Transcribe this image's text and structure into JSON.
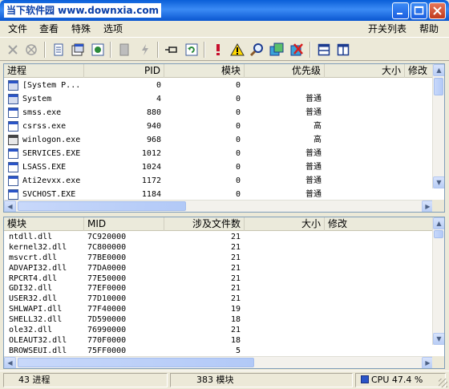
{
  "window": {
    "title": "当下软件园 www.downxia.com"
  },
  "menu": {
    "left": [
      "文件",
      "查看",
      "特殊",
      "选项"
    ],
    "right": [
      "开关列表",
      "帮助"
    ]
  },
  "toolbar": {
    "icons": [
      "close-icon",
      "kill-tree-icon",
      "document-icon",
      "properties-icon",
      "refresh-window-icon",
      "suspend-icon",
      "lightning-icon",
      "pin-icon",
      "reload-icon",
      "exclamation-icon",
      "warning-icon",
      "magnifier-icon",
      "dll-search-icon",
      "red-x-icon",
      "split-horizontal-icon",
      "split-vertical-icon"
    ]
  },
  "process_panel": {
    "columns": [
      "进程",
      "PID",
      "模块",
      "优先级",
      "大小",
      "修改"
    ],
    "rows": [
      {
        "name": "[System P...",
        "pid": "0",
        "modules": "0",
        "priority": "",
        "icon": "system-process-icon"
      },
      {
        "name": "System",
        "pid": "4",
        "modules": "0",
        "priority": "普通",
        "icon": "system-process-icon"
      },
      {
        "name": "smss.exe",
        "pid": "880",
        "modules": "0",
        "priority": "普通",
        "icon": "window-app-icon"
      },
      {
        "name": "csrss.exe",
        "pid": "940",
        "modules": "0",
        "priority": "高",
        "icon": "window-app-icon"
      },
      {
        "name": "winlogon.exe",
        "pid": "968",
        "modules": "0",
        "priority": "高",
        "icon": "winlogon-icon"
      },
      {
        "name": "SERVICES.EXE",
        "pid": "1012",
        "modules": "0",
        "priority": "普通",
        "icon": "window-app-icon"
      },
      {
        "name": "LSASS.EXE",
        "pid": "1024",
        "modules": "0",
        "priority": "普通",
        "icon": "window-app-icon"
      },
      {
        "name": "Ati2evxx.exe",
        "pid": "1172",
        "modules": "0",
        "priority": "普通",
        "icon": "window-app-icon"
      },
      {
        "name": "SVCHOST.EXE",
        "pid": "1184",
        "modules": "0",
        "priority": "普通",
        "icon": "window-app-icon"
      }
    ]
  },
  "module_panel": {
    "columns": [
      "模块",
      "MID",
      "涉及文件数",
      "大小",
      "修改"
    ],
    "rows": [
      {
        "name": "ntdll.dll",
        "mid": "7C920000",
        "count": "21"
      },
      {
        "name": "kernel32.dll",
        "mid": "7C800000",
        "count": "21"
      },
      {
        "name": "msvcrt.dll",
        "mid": "77BE0000",
        "count": "21"
      },
      {
        "name": "ADVAPI32.dll",
        "mid": "77DA0000",
        "count": "21"
      },
      {
        "name": "RPCRT4.dll",
        "mid": "77E50000",
        "count": "21"
      },
      {
        "name": "GDI32.dll",
        "mid": "77EF0000",
        "count": "21"
      },
      {
        "name": "USER32.dll",
        "mid": "77D10000",
        "count": "21"
      },
      {
        "name": "SHLWAPI.dll",
        "mid": "77F40000",
        "count": "19"
      },
      {
        "name": "SHELL32.dll",
        "mid": "7D590000",
        "count": "18"
      },
      {
        "name": "ole32.dll",
        "mid": "76990000",
        "count": "21"
      },
      {
        "name": "OLEAUT32.dll",
        "mid": "770F0000",
        "count": "18"
      },
      {
        "name": "BROWSEUI.dll",
        "mid": "75FF0000",
        "count": "5"
      }
    ]
  },
  "status": {
    "processes": "43 进程",
    "modules": "383 模块",
    "cpu": "CPU 47.4 %"
  },
  "colors": {
    "titlebar": "#0A5FD8",
    "accent": "#2A54C8",
    "face": "#ECE9D8"
  }
}
